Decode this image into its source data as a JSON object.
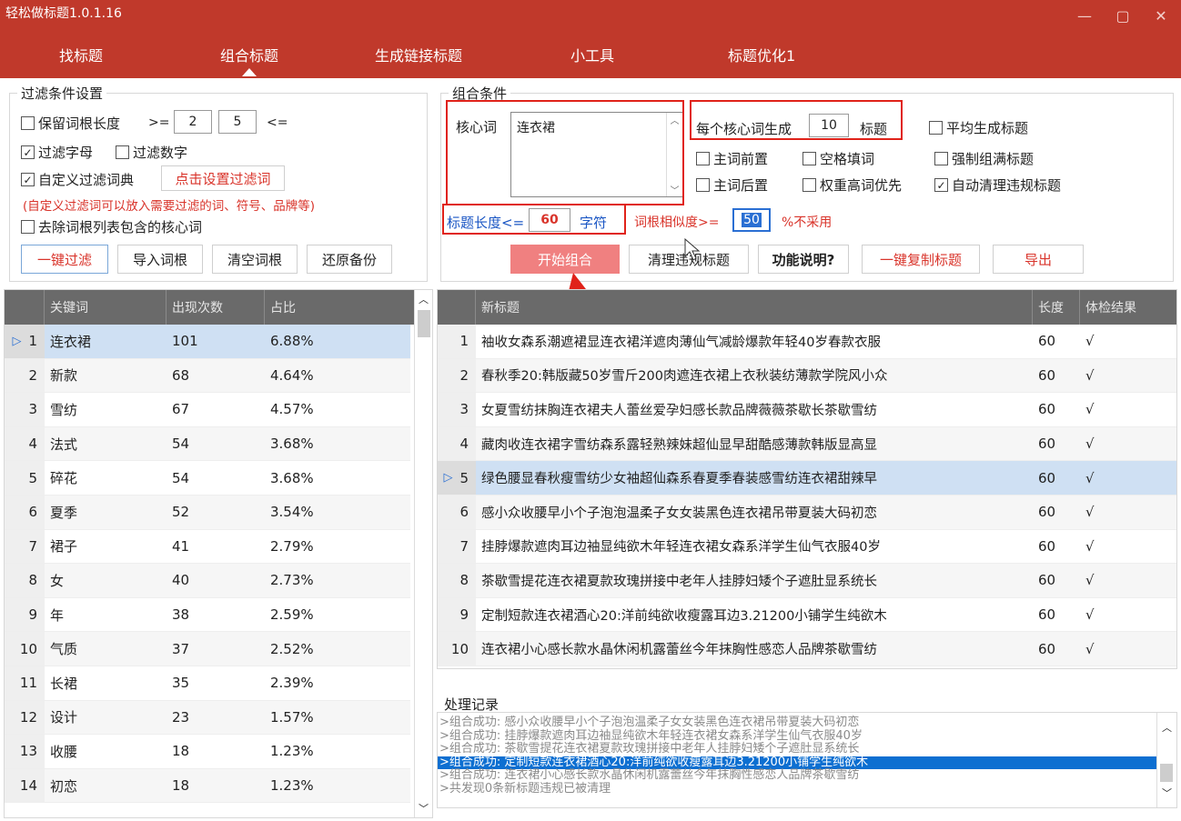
{
  "window": {
    "title": "轻松做标题1.0.1.16",
    "min": "—",
    "max": "▢",
    "close": "✕"
  },
  "nav": {
    "tabs": [
      {
        "label": "找标题"
      },
      {
        "label": "组合标题",
        "active": true
      },
      {
        "label": "生成链接标题"
      },
      {
        "label": "小工具"
      },
      {
        "label": "标题优化1"
      }
    ]
  },
  "filter": {
    "legend": "过滤条件设置",
    "keep_root_len": "保留词根长度",
    "gte": ">=",
    "min_len": "2",
    "max_len": "5",
    "lte": "<=",
    "filter_letters": "过滤字母",
    "filter_numbers": "过滤数字",
    "custom_dict": "自定义过滤词典",
    "set_filter_button": "点击设置过滤词",
    "hint": "(自定义过滤词可以放入需要过滤的词、符号、品牌等)",
    "remove_core": "去除词根列表包含的核心词",
    "buttons": [
      "一键过滤",
      "导入词根",
      "清空词根",
      "还原备份"
    ]
  },
  "combo": {
    "legend": "组合条件",
    "core_label": "核心词",
    "core_value": "连衣裙",
    "per_core_label": "每个核心词生成",
    "per_core_value": "10",
    "per_core_unit": "标题",
    "avg_titles": "平均生成标题",
    "main_front": "主词前置",
    "space_fill": "空格填词",
    "force_full": "强制组满标题",
    "main_back": "主词后置",
    "weight_first": "权重高词优先",
    "auto_clean": "自动清理违规标题",
    "title_len_label": "标题长度<=",
    "title_len_value": "60",
    "title_len_unit": "字符",
    "similarity_label": "词根相似度>=",
    "similarity_value": "50",
    "similarity_unit": "%不采用",
    "buttons": {
      "start": "开始组合",
      "clean": "清理违规标题",
      "help": "功能说明?",
      "copy": "一键复制标题",
      "export": "导出"
    }
  },
  "keywords": {
    "headers": [
      "关键词",
      "出现次数",
      "占比"
    ],
    "rows": [
      [
        "1",
        "连衣裙",
        "101",
        "6.88%"
      ],
      [
        "2",
        "新款",
        "68",
        "4.64%"
      ],
      [
        "3",
        "雪纺",
        "67",
        "4.57%"
      ],
      [
        "4",
        "法式",
        "54",
        "3.68%"
      ],
      [
        "5",
        "碎花",
        "54",
        "3.68%"
      ],
      [
        "6",
        "夏季",
        "52",
        "3.54%"
      ],
      [
        "7",
        "裙子",
        "41",
        "2.79%"
      ],
      [
        "8",
        "女",
        "40",
        "2.73%"
      ],
      [
        "9",
        "年",
        "38",
        "2.59%"
      ],
      [
        "10",
        "气质",
        "37",
        "2.52%"
      ],
      [
        "11",
        "长裙",
        "35",
        "2.39%"
      ],
      [
        "12",
        "设计",
        "23",
        "1.57%"
      ],
      [
        "13",
        "收腰",
        "18",
        "1.23%"
      ],
      [
        "14",
        "初恋",
        "18",
        "1.23%"
      ]
    ]
  },
  "titles": {
    "headers": [
      "新标题",
      "长度",
      "体检结果"
    ],
    "rows": [
      [
        "1",
        "袖收女森系潮遮裙显连衣裙洋遮肉薄仙气减龄爆款年轻40岁春款衣服",
        "60",
        "√"
      ],
      [
        "2",
        "春秋季20:韩版藏50岁雪斤200肉遮连衣裙上衣秋装纺薄款学院风小众",
        "60",
        "√"
      ],
      [
        "3",
        "女夏雪纺抹胸连衣裙夫人蕾丝爱孕妇感长款品牌薇薇茶歇长茶歇雪纺",
        "60",
        "√"
      ],
      [
        "4",
        "藏肉收连衣裙字雪纺森系露轻熟辣妹超仙显早甜酷感薄款韩版显高显",
        "60",
        "√"
      ],
      [
        "5",
        "绿色腰显春秋瘦雪纺少女袖超仙森系春夏季春装感雪纺连衣裙甜辣早",
        "60",
        "√"
      ],
      [
        "6",
        "感小众收腰早小个子泡泡温柔子女女装黑色连衣裙吊带夏装大码初恋",
        "60",
        "√"
      ],
      [
        "7",
        "挂脖爆款遮肉耳边袖显纯欲木年轻连衣裙女森系洋学生仙气衣服40岁",
        "60",
        "√"
      ],
      [
        "8",
        "茶歇雪提花连衣裙夏款玫瑰拼接中老年人挂脖妇矮个子遮肚显系统长",
        "60",
        "√"
      ],
      [
        "9",
        "定制短款连衣裙酒心20:洋前纯欲收瘦露耳边3.21200小铺学生纯欲木",
        "60",
        "√"
      ],
      [
        "10",
        "连衣裙小心感长款水晶休闲机露蕾丝今年抹胸性感恋人品牌茶歇雪纺",
        "60",
        "√"
      ]
    ]
  },
  "log": {
    "label": "处理记录",
    "lines": [
      ">组合成功: 感小众收腰早小个子泡泡温柔子女女装黑色连衣裙吊带夏装大码初恋",
      ">组合成功: 挂脖爆款遮肉耳边袖显纯欲木年轻连衣裙女森系洋学生仙气衣服40岁",
      ">组合成功: 茶歇雪提花连衣裙夏款玫瑰拼接中老年人挂脖妇矮个子遮肚显系统长",
      ">组合成功: 定制短款连衣裙酒心20:洋前纯欲收瘦露耳边3.21200小铺学生纯欲木",
      ">组合成功: 连衣裙小心感长款水晶休闲机露蕾丝今年抹胸性感恋人品牌茶歇雪纺",
      ">共发现0条新标题违规已被清理"
    ]
  }
}
